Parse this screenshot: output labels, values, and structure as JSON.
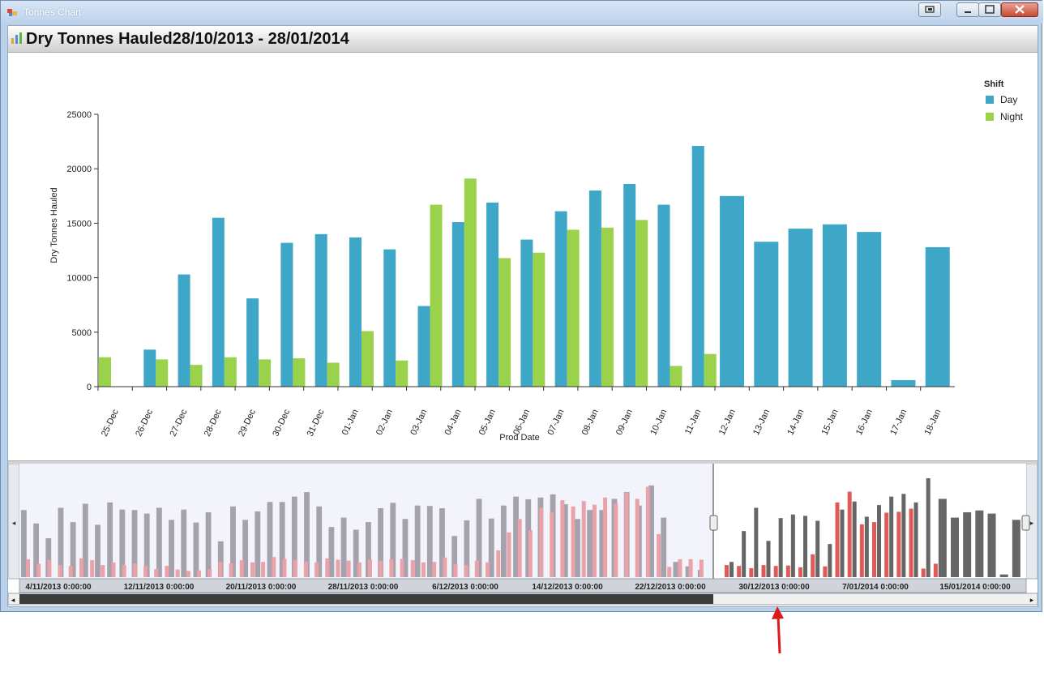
{
  "window": {
    "title": "Tonnes Chart"
  },
  "chart_data": {
    "type": "bar",
    "title": "Dry Tonnes Hauled28/10/2013 - 28/01/2014",
    "xlabel": "Prod Date",
    "ylabel": "Dry Tonnes Hauled",
    "ylim": [
      0,
      25000
    ],
    "yticks": [
      "0",
      "5000",
      "10000",
      "15000",
      "20000",
      "25000"
    ],
    "grid": false,
    "legend_title": "Shift",
    "legend_position": "top-right",
    "categories": [
      "25-Dec",
      "26-Dec",
      "27-Dec",
      "28-Dec",
      "29-Dec",
      "30-Dec",
      "31-Dec",
      "01-Jan",
      "02-Jan",
      "03-Jan",
      "04-Jan",
      "05-Jan",
      "06-Jan",
      "07-Jan",
      "08-Jan",
      "09-Jan",
      "10-Jan",
      "11-Jan",
      "12-Jan",
      "13-Jan",
      "14-Jan",
      "15-Jan",
      "16-Jan",
      "17-Jan",
      "18-Jan"
    ],
    "series": [
      {
        "name": "Day",
        "color": "#3ea6c6",
        "values": [
          null,
          3400,
          10300,
          15500,
          8100,
          13200,
          14000,
          13700,
          12600,
          7400,
          15100,
          16900,
          13500,
          16100,
          18000,
          18600,
          16700,
          22100,
          17500,
          13300,
          14500,
          14900,
          14200,
          600,
          12800
        ]
      },
      {
        "name": "Night",
        "color": "#9ad24c",
        "values": [
          2700,
          2500,
          2000,
          2700,
          2500,
          2600,
          2200,
          5100,
          2400,
          16700,
          19100,
          11800,
          12300,
          14400,
          14600,
          15300,
          1900,
          3000,
          null,
          null,
          null,
          null,
          null,
          null,
          null
        ]
      }
    ]
  },
  "navigator": {
    "x_labels": [
      "4/11/2013 0:00:00",
      "12/11/2013 0:00:00",
      "20/11/2013 0:00:00",
      "28/11/2013 0:00:00",
      "6/12/2013 0:00:00",
      "14/12/2013 0:00:00",
      "22/12/2013 0:00:00",
      "30/12/2013 0:00:00",
      "7/01/2014 0:00:00",
      "15/01/2014 0:00:00"
    ],
    "left_arrow": "◂",
    "right_arrow": "▸",
    "scroll_left": "◂",
    "scroll_right": "▸",
    "day_values_unselected": [
      15000,
      12000,
      8700,
      15500,
      12300,
      16400,
      11700,
      16700,
      15100,
      15000,
      14200,
      15500,
      12800,
      15100,
      12200,
      14500,
      8000,
      15800,
      12800,
      14700,
      16800,
      16800,
      18000,
      19000,
      15800,
      11200,
      13300,
      10600,
      12300,
      15400,
      16600,
      13000,
      16000,
      15900,
      15400,
      9200,
      12700,
      17500,
      13100,
      16000,
      18000,
      17400,
      17800,
      18500,
      16300,
      13000,
      15000,
      15000,
      17500,
      19000,
      16000,
      20500,
      13300,
      3400,
      2400,
      1600
    ],
    "night_values_unselected": [
      4000,
      3000,
      3800,
      2700,
      2500,
      4200,
      3800,
      2700,
      3300,
      2700,
      3100,
      2500,
      1800,
      2500,
      1700,
      1400,
      1500,
      1800,
      3400,
      3100,
      3800,
      3300,
      3400,
      4500,
      4100,
      3900,
      3500,
      3300,
      4200,
      3900,
      3700,
      3300,
      3900,
      3700,
      4000,
      4100,
      3800,
      3300,
      3400,
      4400,
      2900,
      2700,
      3700,
      3300,
      6000,
      10000,
      13000,
      10500,
      15500,
      14500,
      17200,
      15800,
      17000,
      16200,
      17800,
      16500,
      18800,
      17500,
      20200,
      9600,
      2300,
      4000,
      4000,
      3900
    ],
    "day_values_selected": [
      3400,
      10300,
      15500,
      8100,
      13200,
      14000,
      13700,
      12600,
      7400,
      15100,
      16900,
      13500,
      16100,
      18000,
      18600,
      16700,
      22100,
      17500,
      13300,
      14500,
      14900,
      14200,
      600,
      12800
    ],
    "night_values_selected": [
      2700,
      2500,
      2000,
      2700,
      2500,
      2600,
      2200,
      5100,
      2400,
      16700,
      19100,
      11800,
      12300,
      14400,
      14600,
      15300,
      1900,
      3000
    ]
  }
}
